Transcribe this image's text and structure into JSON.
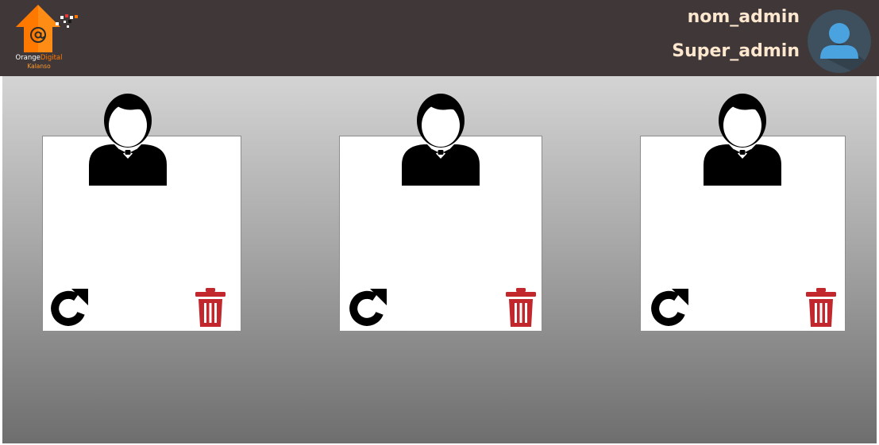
{
  "header": {
    "logo": {
      "brand_word1": "Orange",
      "brand_word2": "Digital",
      "brand_sub": "Kalanso",
      "icon": "orange-house-at-icon",
      "brand_color": "#ff7900"
    },
    "user": {
      "name": "nom_admin",
      "role": "Super_admin",
      "avatar_icon": "user-avatar-icon",
      "avatar_bg": "#3e4f5e",
      "avatar_color": "#4aa3df"
    }
  },
  "cards": [
    {
      "person_icon": "person-bowtie-icon",
      "refresh_icon": "refresh-icon",
      "delete_icon": "trash-icon"
    },
    {
      "person_icon": "person-bowtie-icon",
      "refresh_icon": "refresh-icon",
      "delete_icon": "trash-icon"
    },
    {
      "person_icon": "person-bowtie-icon",
      "refresh_icon": "refresh-icon",
      "delete_icon": "trash-icon"
    }
  ],
  "colors": {
    "header_bg": "#403838",
    "text_accent": "#fde7cf",
    "delete": "#c1272d",
    "refresh": "#000000"
  }
}
